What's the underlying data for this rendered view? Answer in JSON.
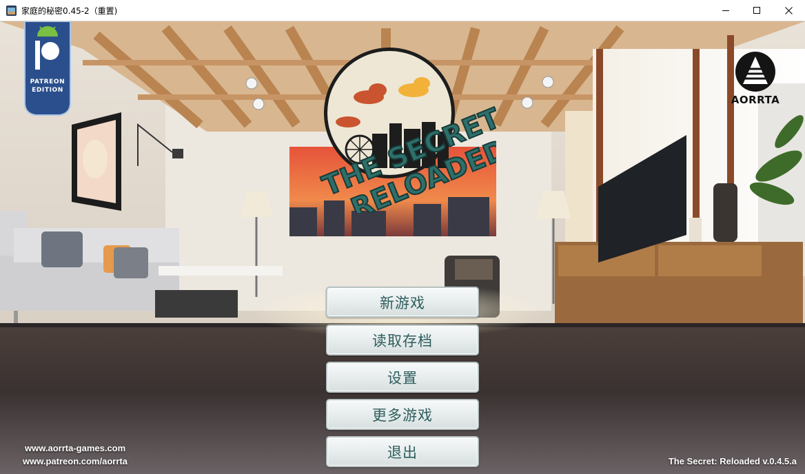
{
  "window": {
    "title": "家庭的秘密0.45-2（重置)",
    "icons": {
      "app": "game-app-icon",
      "minimize": "minimize-icon",
      "maximize": "maximize-icon",
      "close": "close-icon"
    }
  },
  "badges": {
    "patreon_line1": "PATREON",
    "patreon_line2": "EDITION",
    "aorrta": "AORRTA"
  },
  "logo": {
    "line1": "THE SECRET",
    "line2": "RELOADED"
  },
  "menu": {
    "new_game": "新游戏",
    "load": "读取存档",
    "settings": "设置",
    "more_games": "更多游戏",
    "quit": "退出"
  },
  "footer": {
    "website": "www.aorrta-games.com",
    "patreon": "www.patreon.com/aorrta",
    "version": "The Secret: Reloaded v.0.4.5.a"
  },
  "colors": {
    "button_text": "#2e5d5e",
    "logo_text": "#2e6f6a",
    "patreon_blue": "#2b4f8c"
  }
}
